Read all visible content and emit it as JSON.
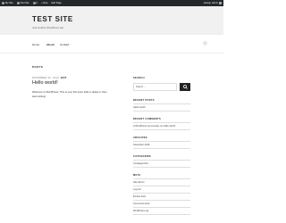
{
  "admin_bar": {
    "items": [
      "My Site",
      "Test Site",
      "0",
      "+ New",
      "Edit Page"
    ],
    "greeting": "Howdy, admin"
  },
  "header": {
    "title": "TEST SITE",
    "tagline": "Just another WordPress site"
  },
  "nav": {
    "items": [
      "Home",
      "About",
      "Contact"
    ]
  },
  "main": {
    "heading": "POSTS",
    "post": {
      "date": "NOVEMBER 20, 2019",
      "edit": "EDIT",
      "title": "Hello world!",
      "body": "Welcome to WordPress. This is your first post. Edit or delete it, then start writing!"
    }
  },
  "sidebar": {
    "search": {
      "heading": "SEARCH",
      "placeholder": "Search ..."
    },
    "recent_posts": {
      "heading": "RECENT POSTS",
      "items": [
        "Hello world!"
      ]
    },
    "recent_comments": {
      "heading": "RECENT COMMENTS",
      "items": [
        "A WordPress Commenter on Hello world!"
      ]
    },
    "archives": {
      "heading": "ARCHIVES",
      "items": [
        "November 2019"
      ]
    },
    "categories": {
      "heading": "CATEGORIES",
      "items": [
        "Uncategorized"
      ]
    },
    "meta": {
      "heading": "META",
      "items": [
        "Site Admin",
        "Log out",
        "Entries feed",
        "Comments feed",
        "WordPress.org"
      ]
    }
  },
  "colors": {
    "admin_bar": "#23282d",
    "header_bg": "#f1f1f1",
    "text": "#222222"
  }
}
